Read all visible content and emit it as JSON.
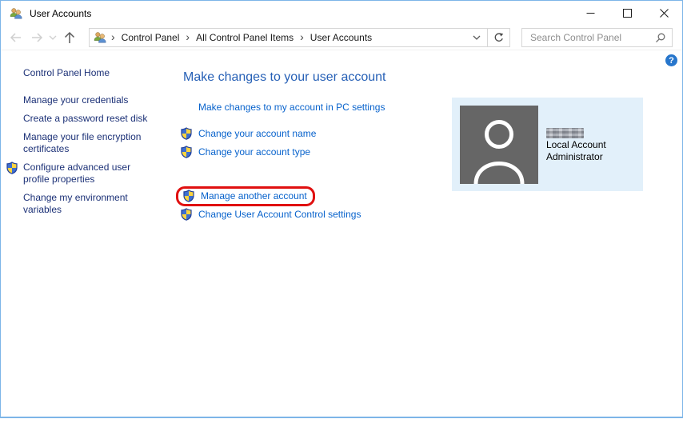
{
  "window": {
    "title": "User Accounts"
  },
  "navbar": {
    "breadcrumb": {
      "items": [
        "Control Panel",
        "All Control Panel Items",
        "User Accounts"
      ]
    },
    "search_placeholder": "Search Control Panel"
  },
  "sidebar": {
    "home_label": "Control Panel Home",
    "tasks": [
      {
        "label": "Manage your credentials",
        "shield": false
      },
      {
        "label": "Create a password reset disk",
        "shield": false
      },
      {
        "label": "Manage your file encryption certificates",
        "shield": false
      },
      {
        "label": "Configure advanced user profile properties",
        "shield": true
      },
      {
        "label": "Change my environment variables",
        "shield": false
      }
    ]
  },
  "main": {
    "heading": "Make changes to your user account",
    "pc_settings_link": "Make changes to my account in PC settings",
    "action_links": [
      {
        "label": "Change your account name",
        "shield": true,
        "highlighted": false
      },
      {
        "label": "Change your account type",
        "shield": true,
        "highlighted": false
      },
      {
        "label": "Manage another account",
        "shield": true,
        "highlighted": true
      },
      {
        "label": "Change User Account Control settings",
        "shield": true,
        "highlighted": false
      }
    ],
    "account_panel": {
      "username_obscured": true,
      "account_type": "Local Account",
      "role": "Administrator"
    },
    "help_label": "?"
  },
  "colors": {
    "window_border": "#7db5e8",
    "heading_blue": "#2660b6",
    "link_blue": "#0762cc",
    "sidebar_navy": "#1c3177",
    "annotation_red": "#e01010",
    "panel_background": "#e2f0fa",
    "avatar_gray": "#666666",
    "help_blue": "#2776cc"
  }
}
